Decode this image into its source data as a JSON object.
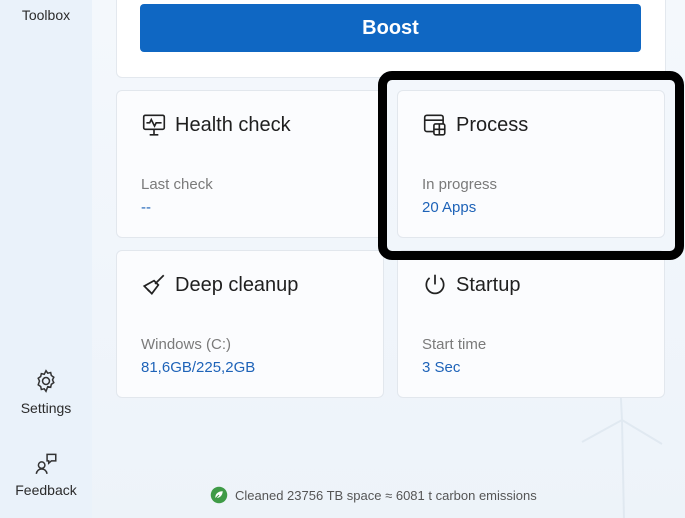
{
  "sidebar": {
    "items": [
      {
        "label": "Toolbox",
        "icon": "toolbox-icon"
      },
      {
        "label": "Settings",
        "icon": "gear-icon"
      },
      {
        "label": "Feedback",
        "icon": "feedback-icon"
      }
    ]
  },
  "boost": {
    "label": "Boost",
    "color": "#0f67c3"
  },
  "tiles": {
    "health": {
      "title": "Health check",
      "label": "Last check",
      "value": "--",
      "icon": "health-monitor-icon"
    },
    "process": {
      "title": "Process",
      "label": "In progress",
      "value": "20 Apps",
      "icon": "process-window-icon"
    },
    "cleanup": {
      "title": "Deep cleanup",
      "label": "Windows (C:)",
      "value": "81,6GB/225,2GB",
      "icon": "broom-icon"
    },
    "startup": {
      "title": "Startup",
      "label": "Start time",
      "value": "3 Sec",
      "icon": "power-icon"
    }
  },
  "footer": {
    "status": "Cleaned 23756 TB space ≈ 6081 t carbon emissions",
    "icon": "eco-leaf-icon"
  },
  "colors": {
    "accent": "#0f67c3",
    "value_text": "#1e63b8",
    "highlight": "#000000"
  }
}
